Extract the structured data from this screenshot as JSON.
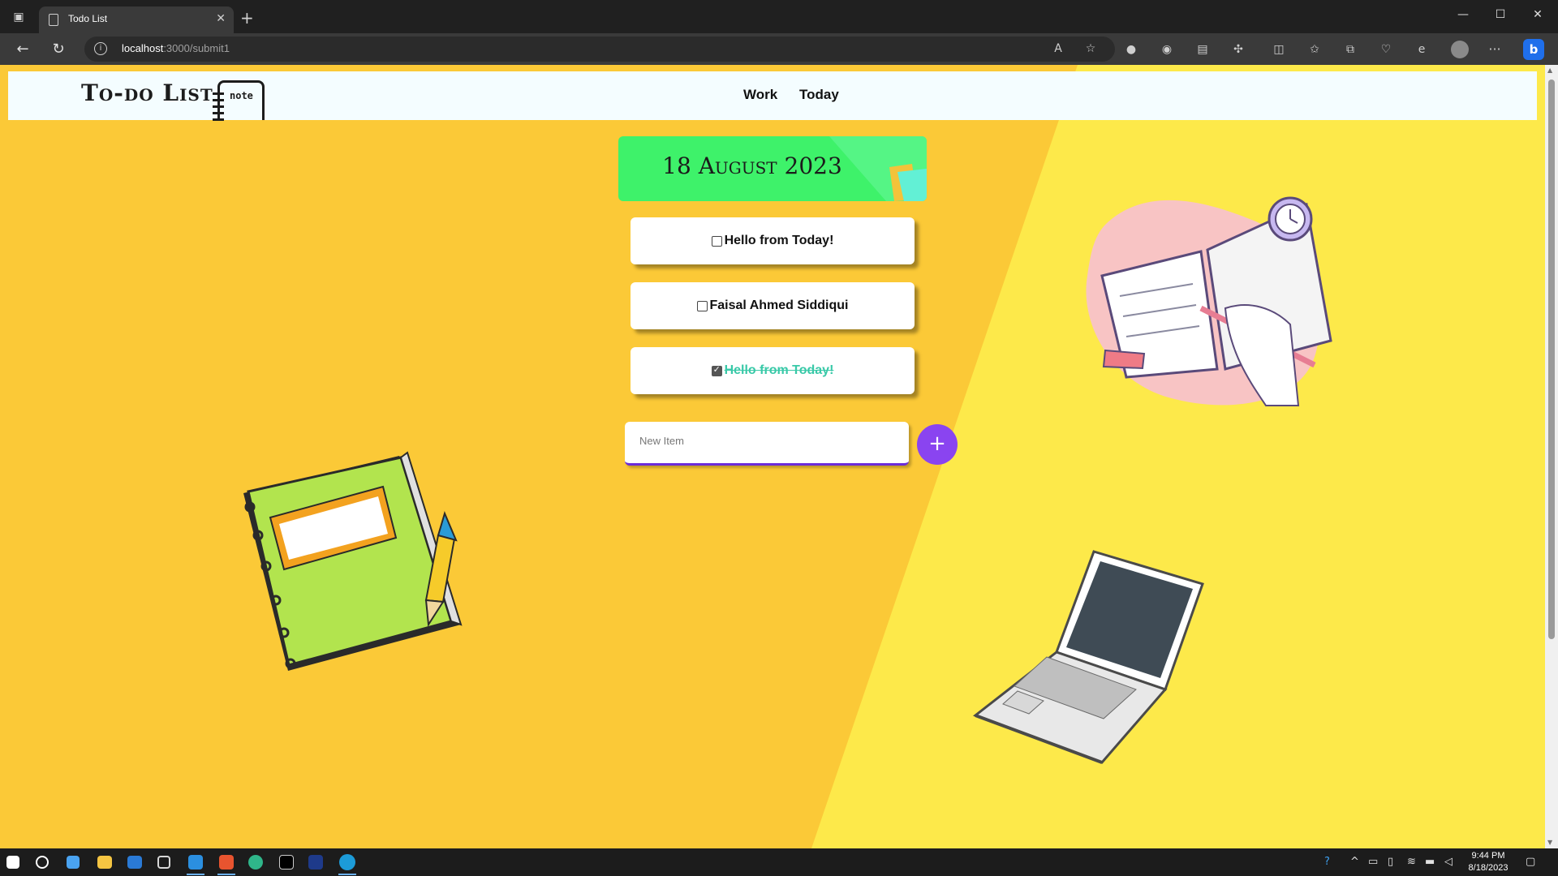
{
  "browser": {
    "tab_title": "Todo List",
    "tab_close": "✕",
    "new_tab": "+",
    "address_host": "localhost",
    "address_path": ":3000/submit1",
    "window_controls": {
      "minimize": "—",
      "maximize": "☐",
      "close": "✕"
    },
    "more_menu": "···"
  },
  "site": {
    "logo_text": "To-do List",
    "logo_note_text": "note",
    "nav": [
      {
        "label": "Work"
      },
      {
        "label": "Today"
      }
    ]
  },
  "list": {
    "date_heading": "18 August 2023",
    "items": [
      {
        "text": "Hello from Today!",
        "checked": false
      },
      {
        "text": "Faisal Ahmed Siddiqui",
        "checked": false
      },
      {
        "text": "Hello from Today!",
        "checked": true
      }
    ],
    "new_item_placeholder": "New Item",
    "add_button_label": "+"
  },
  "taskbar": {
    "time": "9:44 PM",
    "date": "8/18/2023"
  },
  "colors": {
    "page_left": "#fbc937",
    "page_right": "#fde94a",
    "header_bg": "#f4fdff",
    "date_banner": "#3ef26a",
    "add_button": "#8a44f0",
    "done_text": "#39c9a8"
  }
}
